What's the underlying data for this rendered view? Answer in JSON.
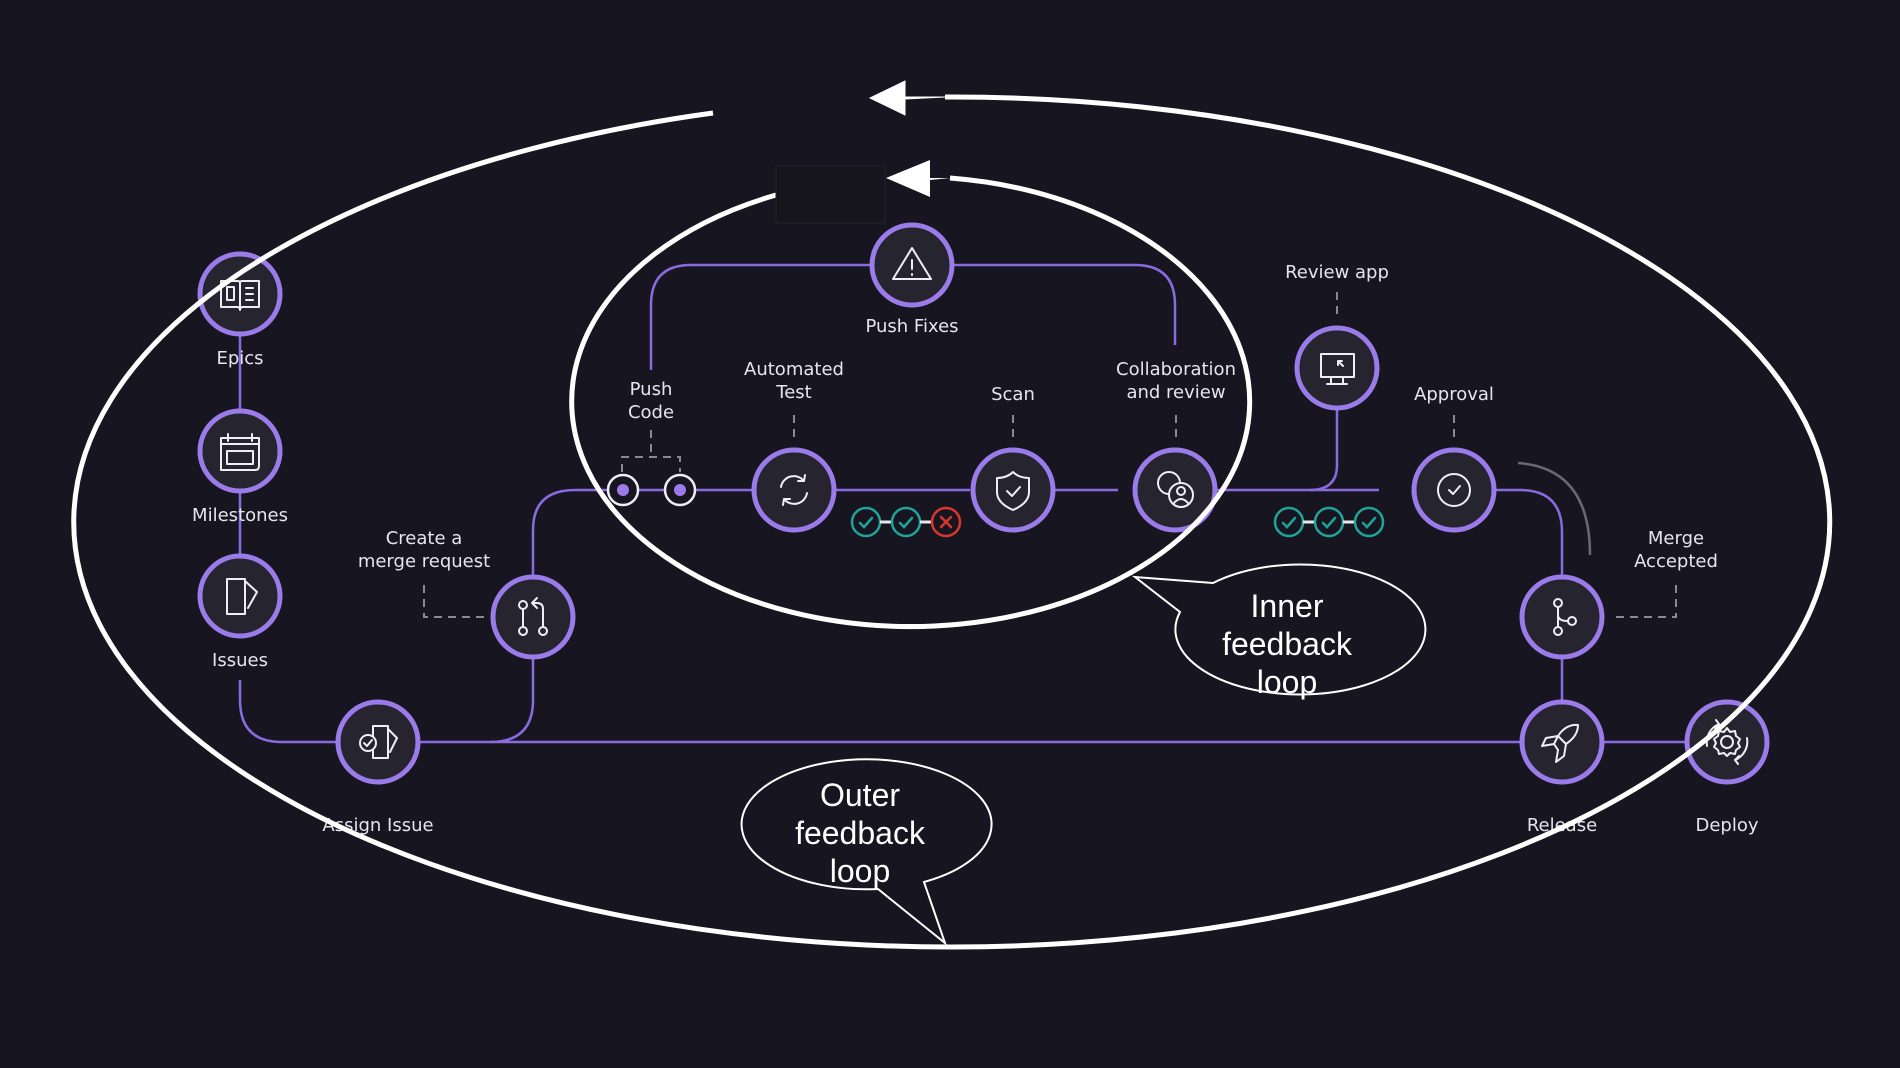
{
  "colors": {
    "background": "#171620",
    "node_ring": "#9b7bea",
    "node_fill": "#26242f",
    "flow_line": "#8a6ae0",
    "loop_line": "#ffffff",
    "check_pass": "#1fa39a",
    "check_fail": "#d9372b"
  },
  "nodes": {
    "epics": {
      "label": "Epics",
      "icon": "book-icon"
    },
    "milestones": {
      "label": "Milestones",
      "icon": "calendar-icon"
    },
    "issues": {
      "label": "Issues",
      "icon": "issue-icon"
    },
    "assign_issue": {
      "label": "Assign Issue",
      "icon": "assign-issue-icon"
    },
    "merge_request": {
      "label_line1": "Create a",
      "label_line2": "merge request",
      "icon": "merge-request-icon"
    },
    "push_code": {
      "label_line1": "Push",
      "label_line2": "Code",
      "icon": "commit-icon"
    },
    "automated_test": {
      "label_line1": "Automated",
      "label_line2": "Test",
      "icon": "refresh-icon"
    },
    "scan": {
      "label": "Scan",
      "icon": "shield-check-icon"
    },
    "collaboration": {
      "label_line1": "Collaboration",
      "label_line2": "and review",
      "icon": "users-icon"
    },
    "push_fixes": {
      "label": "Push Fixes",
      "icon": "warning-icon"
    },
    "review_app": {
      "label": "Review app",
      "icon": "monitor-icon"
    },
    "approval": {
      "label": "Approval",
      "icon": "check-circle-icon"
    },
    "merge_accepted": {
      "label_line1": "Merge",
      "label_line2": "Accepted",
      "icon": "branch-icon"
    },
    "release": {
      "label": "Release",
      "icon": "rocket-icon"
    },
    "deploy": {
      "label": "Deploy",
      "icon": "gear-cycle-icon"
    }
  },
  "pipeline_status_inner": [
    "pass",
    "pass",
    "fail"
  ],
  "pipeline_status_outer": [
    "pass",
    "pass",
    "pass"
  ],
  "callouts": {
    "inner": {
      "line1": "Inner",
      "line2": "feedback",
      "line3": "loop"
    },
    "outer": {
      "line1": "Outer",
      "line2": "feedback",
      "line3": "loop"
    }
  }
}
